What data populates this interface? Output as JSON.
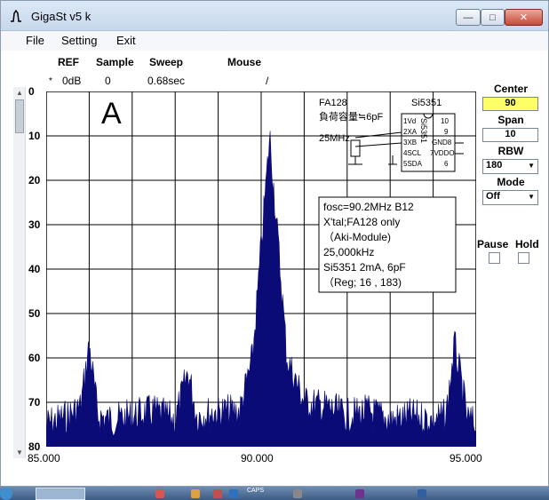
{
  "window": {
    "title": "GigaSt v5 k",
    "minimize_label": "—",
    "maximize_label": "□",
    "close_label": "✕"
  },
  "menu": {
    "file": "File",
    "setting": "Setting",
    "exit": "Exit"
  },
  "header": {
    "ref_label": "REF",
    "sample_label": "Sample",
    "sweep_label": "Sweep",
    "mouse_label": "Mouse",
    "marker": "*",
    "ref_value": "0dB",
    "sample_value": "0",
    "sweep_value": "0.68sec",
    "mouse_value": "/"
  },
  "graph": {
    "channel_label": "A",
    "y_ticks": [
      "0",
      "10",
      "20",
      "30",
      "40",
      "50",
      "60",
      "70",
      "80"
    ],
    "x_ticks": [
      "85.000",
      "90.000",
      "95.000"
    ],
    "trace_color": "#0b0b78",
    "chip": {
      "title_left": "FA128",
      "title_right": "Si5351",
      "load_cap": "負荷容量≒6pF",
      "freq": "25MHz",
      "pins_left": [
        "1Vd",
        "2XA",
        "3XB",
        "4SCL",
        "5SDA"
      ],
      "pins_right": [
        "10",
        "9",
        "GND8",
        "7VDDO",
        "6"
      ],
      "chip_name": "Si5351"
    },
    "info_lines": [
      "fosc=90.2MHz B12",
      "X'tal;FA128 only",
      "（Aki-Module)",
      "25,000kHz",
      "Si5351 2mA, 6pF",
      "（Reg;  16 , 183)"
    ]
  },
  "chart_data": {
    "type": "line",
    "xlabel": "",
    "ylabel": "",
    "xlim": [
      85.0,
      95.0
    ],
    "ylim": [
      80,
      0
    ],
    "x": [
      85.0,
      85.5,
      85.8,
      86.0,
      86.2,
      86.5,
      87.0,
      87.5,
      88.0,
      88.3,
      88.5,
      89.0,
      89.5,
      89.8,
      90.0,
      90.2,
      90.4,
      90.6,
      91.0,
      91.5,
      92.0,
      92.5,
      93.0,
      93.5,
      94.0,
      94.3,
      94.5,
      94.8,
      95.0
    ],
    "y": [
      75,
      73,
      71,
      57,
      73,
      74,
      73,
      72,
      74,
      63,
      73,
      72,
      72,
      60,
      35,
      10,
      35,
      60,
      70,
      71,
      73,
      72,
      74,
      73,
      74,
      73,
      57,
      74,
      75
    ]
  },
  "right_panel": {
    "center_label": "Center",
    "center_value": "90",
    "center_color": "#ffff66",
    "span_label": "Span",
    "span_value": "10",
    "rbw_label": "RBW",
    "rbw_value": "180",
    "mode_label": "Mode",
    "mode_value": "Off",
    "pause_label": "Pause",
    "hold_label": "Hold"
  },
  "taskbar": {
    "caps": "CAPS"
  }
}
